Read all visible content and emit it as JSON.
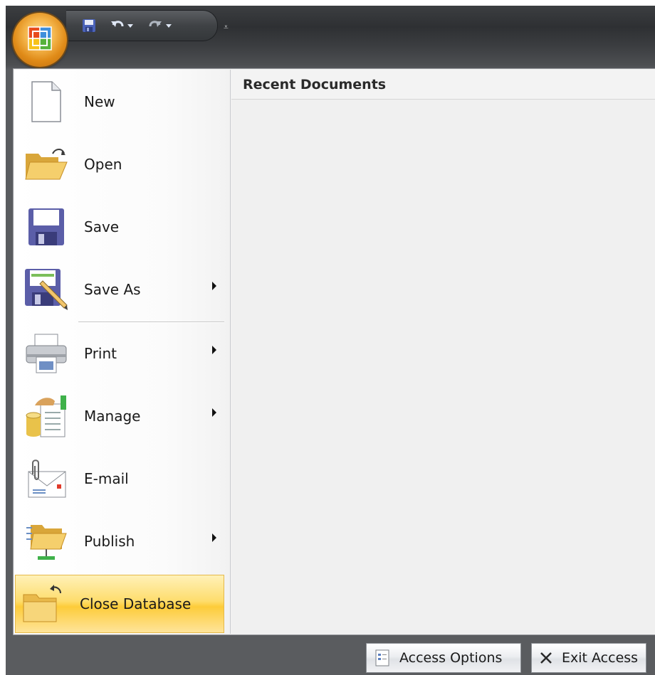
{
  "quick_access": {
    "items": [
      "save-icon",
      "undo-icon",
      "redo-icon",
      "customize-icon"
    ]
  },
  "menu": {
    "items": [
      {
        "label": "New",
        "icon": "new-document-icon",
        "submenu": false
      },
      {
        "label": "Open",
        "icon": "open-folder-icon",
        "submenu": false
      },
      {
        "label": "Save",
        "icon": "floppy-disk-icon",
        "submenu": false
      },
      {
        "label": "Save As",
        "icon": "save-as-icon",
        "submenu": true
      },
      {
        "label": "Print",
        "icon": "printer-icon",
        "submenu": true
      },
      {
        "label": "Manage",
        "icon": "manage-database-icon",
        "submenu": true
      },
      {
        "label": "E-mail",
        "icon": "email-icon",
        "submenu": false
      },
      {
        "label": "Publish",
        "icon": "publish-folder-icon",
        "submenu": true
      },
      {
        "label": "Close Database",
        "icon": "close-folder-icon",
        "submenu": false,
        "highlighted": true
      }
    ]
  },
  "recent": {
    "title": "Recent Documents"
  },
  "footer": {
    "options_label": "Access Options",
    "exit_label": "Exit Access"
  },
  "colors": {
    "highlight": "#fdcc3a",
    "chrome": "#3c3e41",
    "accent_orange": "#e08b18"
  }
}
